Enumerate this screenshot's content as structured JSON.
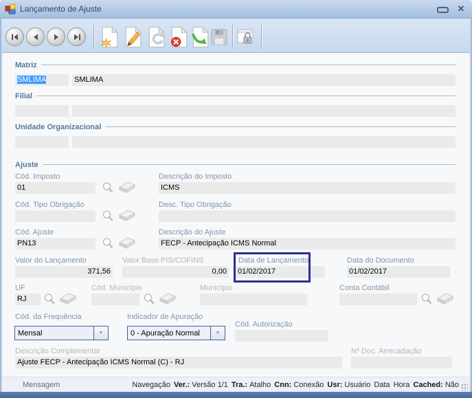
{
  "colors": {
    "titlebar_blue": "#aac2e2",
    "toolbar_blue": "#cfdff1",
    "highlight_border": "#2c2f8e",
    "selection_blue": "#3d9bfd",
    "section_title": "#54789d",
    "bottom_band": "#4d74a5"
  },
  "window": {
    "title": "Lançamento de Ajuste",
    "icon": "form-icon",
    "minimize_icon": "minimize-icon",
    "close_icon": "close-icon",
    "close_glyph": "✕"
  },
  "toolbar": {
    "buttons": [
      "first-record",
      "previous-record",
      "next-record",
      "last-record",
      "new-record",
      "edit-record",
      "undo",
      "delete-record",
      "post-record",
      "save-record",
      "permissions-lock"
    ]
  },
  "sections": {
    "matriz": {
      "title": "Matriz",
      "code": "SMLIMA",
      "name": "SMLIMA"
    },
    "filial": {
      "title": "Filial",
      "code": "",
      "name": ""
    },
    "unidade_organizacional": {
      "title": "Unidade Organizacional",
      "code": "",
      "name": ""
    },
    "ajuste": {
      "title": "Ajuste"
    }
  },
  "fields": {
    "cod_imposto": {
      "label": "Cód. Imposto",
      "value": "01"
    },
    "desc_imposto": {
      "label": "Descrição do Imposto",
      "value": "ICMS"
    },
    "cod_tipo_obrigacao": {
      "label": "Cód. Tipo Obrigação",
      "value": ""
    },
    "desc_tipo_obrigacao": {
      "label": "Desc. Tipo Obrigação",
      "value": ""
    },
    "cod_ajuste": {
      "label": "Cód. Ajuste",
      "value": "PN13"
    },
    "desc_ajuste": {
      "label": "Descrição do Ajuste",
      "value": "FECP - Antecipação ICMS Normal"
    },
    "valor_lancamento": {
      "label": "Valor do Lançamento",
      "value": "371,56"
    },
    "valor_base_pis_cofins": {
      "label": "Valor Base PIS/COFINS",
      "value": "0,00"
    },
    "data_lancamento": {
      "label": "Data de Lançamento",
      "value": "01/02/2017",
      "highlighted": true
    },
    "data_documento": {
      "label": "Data do Documento",
      "value": "01/02/2017"
    },
    "uf": {
      "label": "UF",
      "value": "RJ"
    },
    "cod_municipio": {
      "label": "Cód. Município",
      "value": ""
    },
    "municipio": {
      "label": "Município",
      "value": ""
    },
    "conta_contabil": {
      "label": "Conta Contábil",
      "value": ""
    },
    "cod_frequencia": {
      "label": "Cód. da Frequência",
      "value": "Mensal"
    },
    "indicador_apuracao": {
      "label": "Indicador de Apuração",
      "value": "0 - Apuração Normal"
    },
    "cod_autorizacao": {
      "label": "Cód. Autorização",
      "value": ""
    },
    "descricao_complementar": {
      "label": "Descrição Complementar",
      "value": "Ajuste FECP - Antecipação ICMS Normal (C) - RJ"
    },
    "num_doc_arrecadacao": {
      "label": "Nº Doc. Arrecadação",
      "value": ""
    }
  },
  "status_bar": {
    "message": "Mensagem",
    "navegacao": "Navegação",
    "ver_label": "Ver.:",
    "ver_value": "Versão 1/1",
    "tra_label": "Tra.:",
    "tra_value": "Atalho",
    "cnn_label": "Cnn:",
    "cnn_value": "Conexão",
    "usr_label": "Usr:",
    "usr_value": "Usuário",
    "data": "Data",
    "hora": "Hora",
    "cached_label": "Cached:",
    "cached_value": "Não"
  }
}
